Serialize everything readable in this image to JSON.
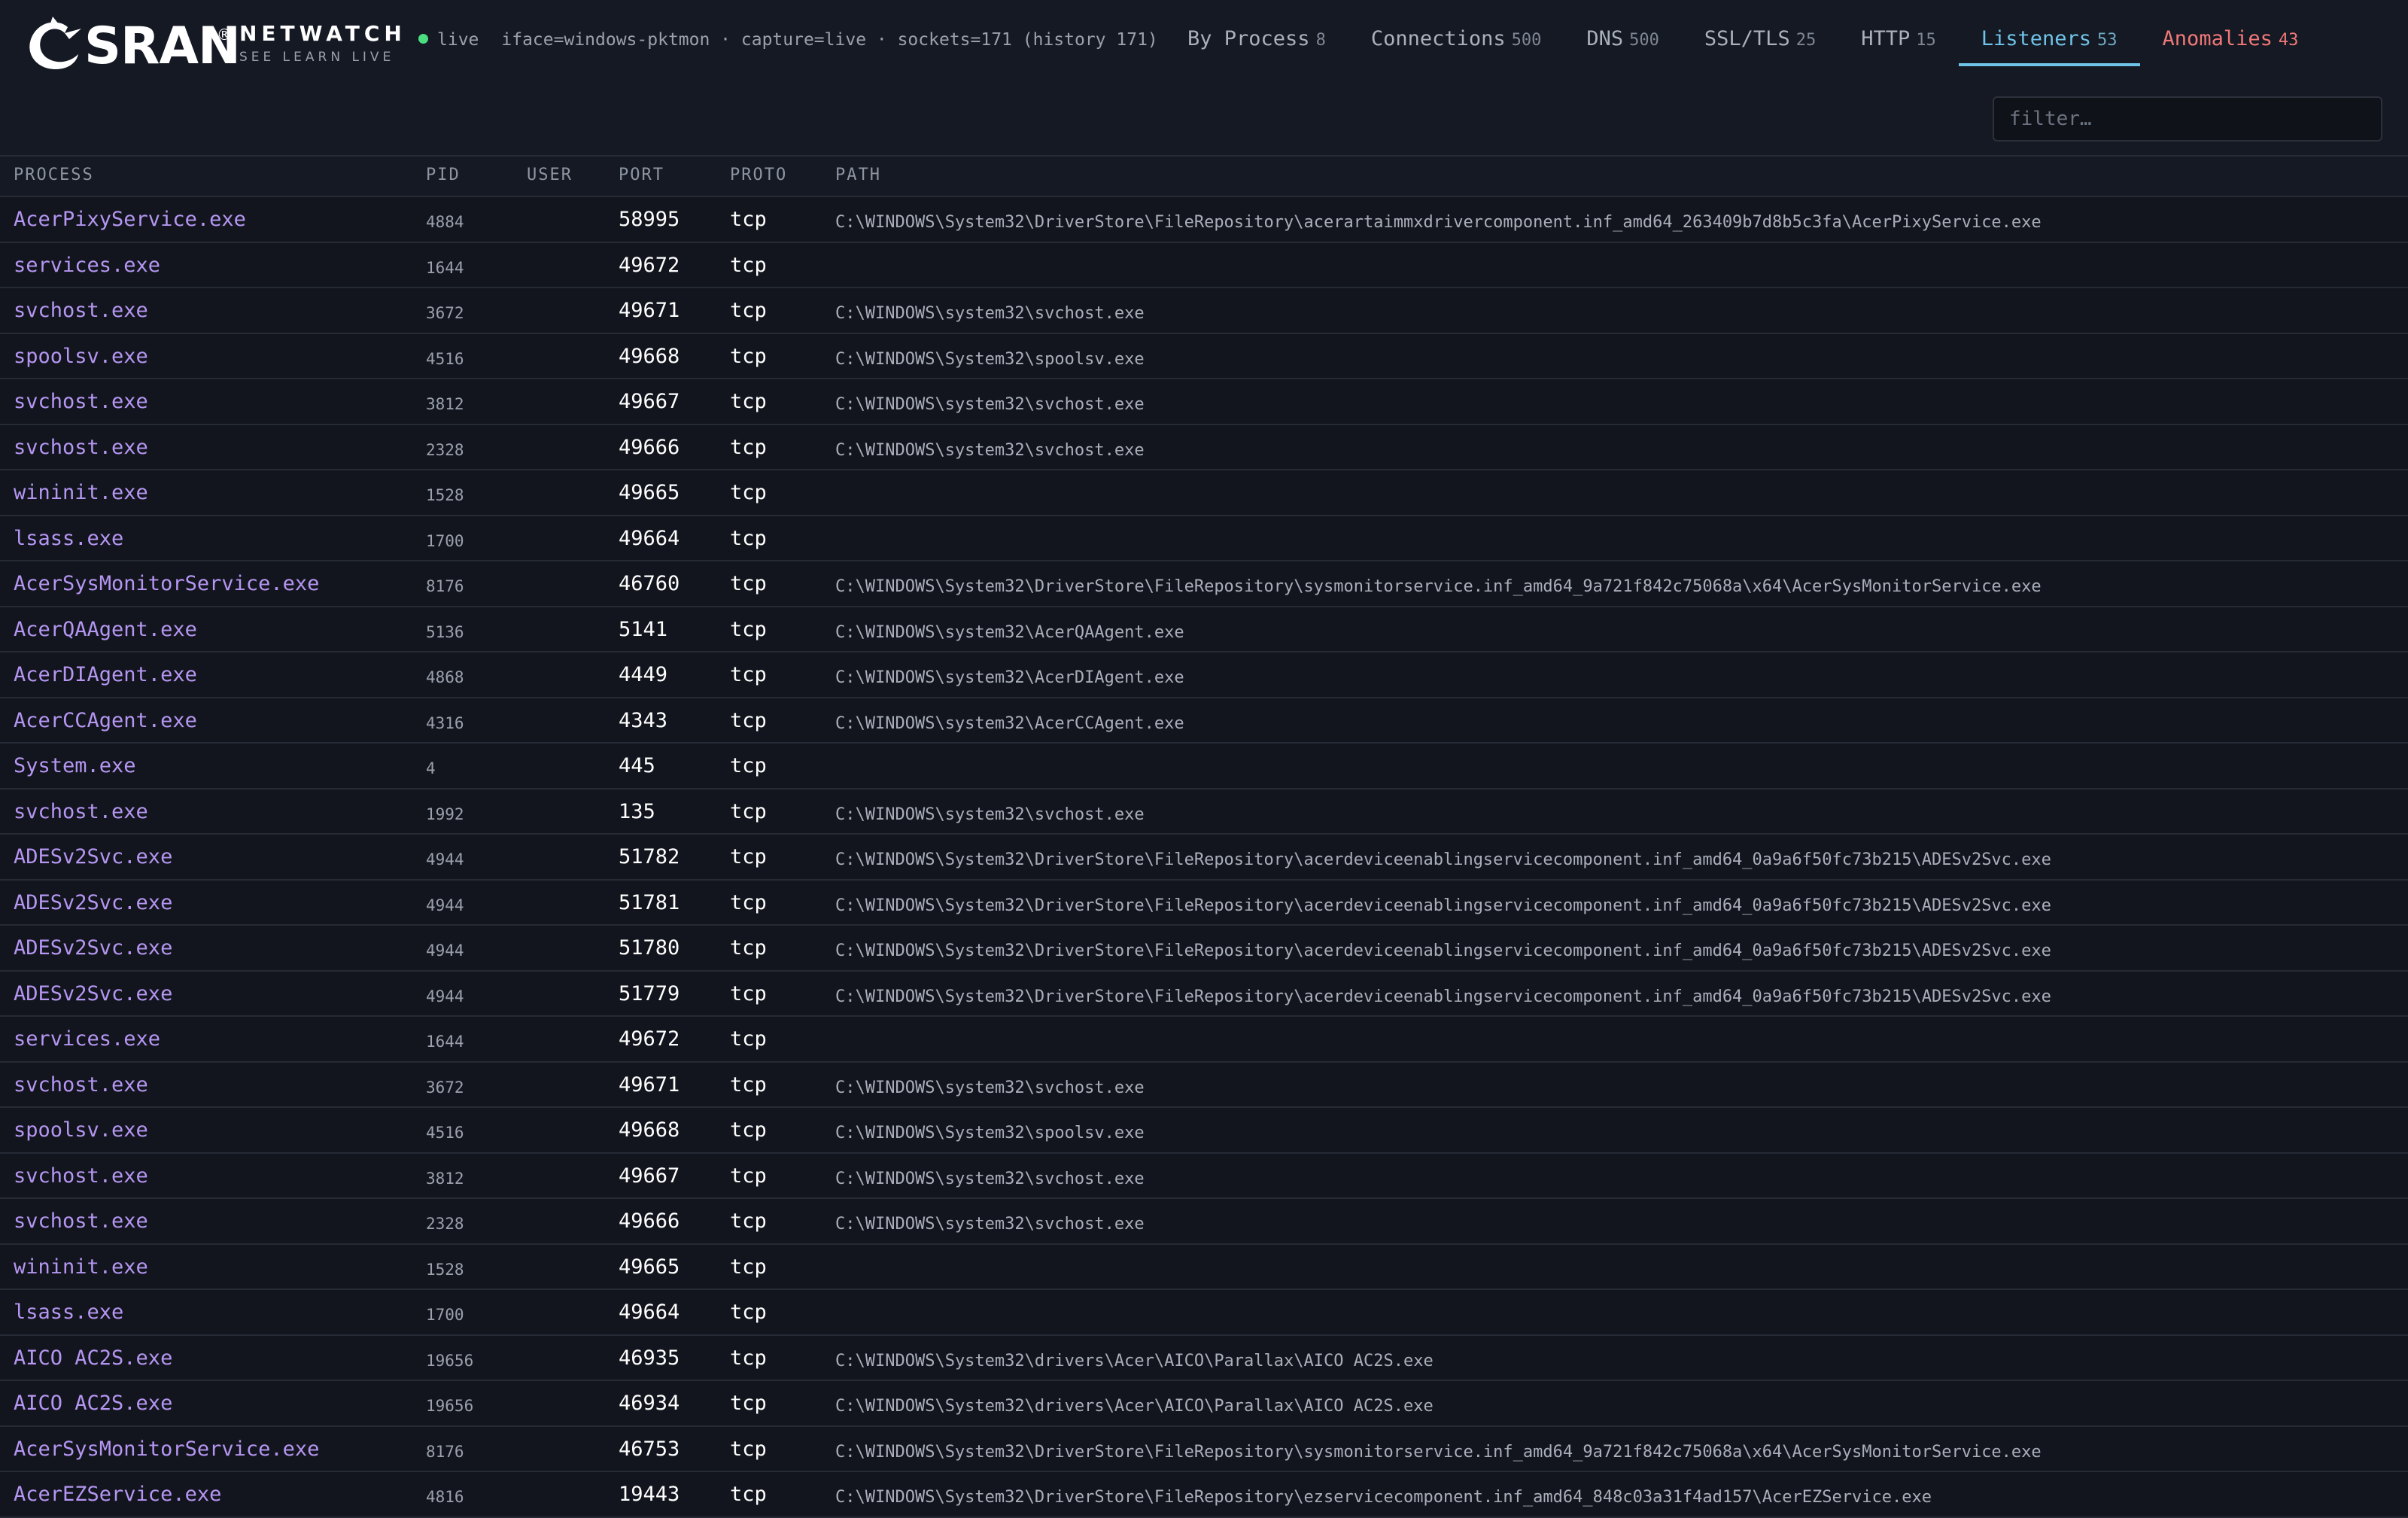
{
  "brand": {
    "name": "SRAN",
    "registered": "®",
    "product": "NETWATCH",
    "tagline": "SEE LEARN LIVE"
  },
  "status": {
    "live_label": "live",
    "details": "iface=windows-pktmon · capture=live · sockets=171 (history 171)"
  },
  "tabs": [
    {
      "label": "By Process",
      "count": "8"
    },
    {
      "label": "Connections",
      "count": "500"
    },
    {
      "label": "DNS",
      "count": "500"
    },
    {
      "label": "SSL/TLS",
      "count": "25"
    },
    {
      "label": "HTTP",
      "count": "15"
    },
    {
      "label": "Listeners",
      "count": "53"
    },
    {
      "label": "Anomalies",
      "count": "43"
    }
  ],
  "active_tab": "Listeners",
  "filter": {
    "placeholder": "filter…",
    "value": ""
  },
  "columns": {
    "process": "PROCESS",
    "pid": "PID",
    "user": "USER",
    "port": "PORT",
    "proto": "PROTO",
    "path": "PATH"
  },
  "rows": [
    {
      "process": "AcerPixyService.exe",
      "pid": "4884",
      "user": "",
      "port": "58995",
      "proto": "tcp",
      "path": "C:\\WINDOWS\\System32\\DriverStore\\FileRepository\\acerartaimmxdrivercomponent.inf_amd64_263409b7d8b5c3fa\\AcerPixyService.exe"
    },
    {
      "process": "services.exe",
      "pid": "1644",
      "user": "",
      "port": "49672",
      "proto": "tcp",
      "path": ""
    },
    {
      "process": "svchost.exe",
      "pid": "3672",
      "user": "",
      "port": "49671",
      "proto": "tcp",
      "path": "C:\\WINDOWS\\system32\\svchost.exe"
    },
    {
      "process": "spoolsv.exe",
      "pid": "4516",
      "user": "",
      "port": "49668",
      "proto": "tcp",
      "path": "C:\\WINDOWS\\System32\\spoolsv.exe"
    },
    {
      "process": "svchost.exe",
      "pid": "3812",
      "user": "",
      "port": "49667",
      "proto": "tcp",
      "path": "C:\\WINDOWS\\system32\\svchost.exe"
    },
    {
      "process": "svchost.exe",
      "pid": "2328",
      "user": "",
      "port": "49666",
      "proto": "tcp",
      "path": "C:\\WINDOWS\\system32\\svchost.exe"
    },
    {
      "process": "wininit.exe",
      "pid": "1528",
      "user": "",
      "port": "49665",
      "proto": "tcp",
      "path": ""
    },
    {
      "process": "lsass.exe",
      "pid": "1700",
      "user": "",
      "port": "49664",
      "proto": "tcp",
      "path": ""
    },
    {
      "process": "AcerSysMonitorService.exe",
      "pid": "8176",
      "user": "",
      "port": "46760",
      "proto": "tcp",
      "path": "C:\\WINDOWS\\System32\\DriverStore\\FileRepository\\sysmonitorservice.inf_amd64_9a721f842c75068a\\x64\\AcerSysMonitorService.exe"
    },
    {
      "process": "AcerQAAgent.exe",
      "pid": "5136",
      "user": "",
      "port": "5141",
      "proto": "tcp",
      "path": "C:\\WINDOWS\\system32\\AcerQAAgent.exe"
    },
    {
      "process": "AcerDIAgent.exe",
      "pid": "4868",
      "user": "",
      "port": "4449",
      "proto": "tcp",
      "path": "C:\\WINDOWS\\system32\\AcerDIAgent.exe"
    },
    {
      "process": "AcerCCAgent.exe",
      "pid": "4316",
      "user": "",
      "port": "4343",
      "proto": "tcp",
      "path": "C:\\WINDOWS\\system32\\AcerCCAgent.exe"
    },
    {
      "process": "System.exe",
      "pid": "4",
      "user": "",
      "port": "445",
      "proto": "tcp",
      "path": ""
    },
    {
      "process": "svchost.exe",
      "pid": "1992",
      "user": "",
      "port": "135",
      "proto": "tcp",
      "path": "C:\\WINDOWS\\system32\\svchost.exe"
    },
    {
      "process": "ADESv2Svc.exe",
      "pid": "4944",
      "user": "",
      "port": "51782",
      "proto": "tcp",
      "path": "C:\\WINDOWS\\System32\\DriverStore\\FileRepository\\acerdeviceenablingservicecomponent.inf_amd64_0a9a6f50fc73b215\\ADESv2Svc.exe"
    },
    {
      "process": "ADESv2Svc.exe",
      "pid": "4944",
      "user": "",
      "port": "51781",
      "proto": "tcp",
      "path": "C:\\WINDOWS\\System32\\DriverStore\\FileRepository\\acerdeviceenablingservicecomponent.inf_amd64_0a9a6f50fc73b215\\ADESv2Svc.exe"
    },
    {
      "process": "ADESv2Svc.exe",
      "pid": "4944",
      "user": "",
      "port": "51780",
      "proto": "tcp",
      "path": "C:\\WINDOWS\\System32\\DriverStore\\FileRepository\\acerdeviceenablingservicecomponent.inf_amd64_0a9a6f50fc73b215\\ADESv2Svc.exe"
    },
    {
      "process": "ADESv2Svc.exe",
      "pid": "4944",
      "user": "",
      "port": "51779",
      "proto": "tcp",
      "path": "C:\\WINDOWS\\System32\\DriverStore\\FileRepository\\acerdeviceenablingservicecomponent.inf_amd64_0a9a6f50fc73b215\\ADESv2Svc.exe"
    },
    {
      "process": "services.exe",
      "pid": "1644",
      "user": "",
      "port": "49672",
      "proto": "tcp",
      "path": ""
    },
    {
      "process": "svchost.exe",
      "pid": "3672",
      "user": "",
      "port": "49671",
      "proto": "tcp",
      "path": "C:\\WINDOWS\\system32\\svchost.exe"
    },
    {
      "process": "spoolsv.exe",
      "pid": "4516",
      "user": "",
      "port": "49668",
      "proto": "tcp",
      "path": "C:\\WINDOWS\\System32\\spoolsv.exe"
    },
    {
      "process": "svchost.exe",
      "pid": "3812",
      "user": "",
      "port": "49667",
      "proto": "tcp",
      "path": "C:\\WINDOWS\\system32\\svchost.exe"
    },
    {
      "process": "svchost.exe",
      "pid": "2328",
      "user": "",
      "port": "49666",
      "proto": "tcp",
      "path": "C:\\WINDOWS\\system32\\svchost.exe"
    },
    {
      "process": "wininit.exe",
      "pid": "1528",
      "user": "",
      "port": "49665",
      "proto": "tcp",
      "path": ""
    },
    {
      "process": "lsass.exe",
      "pid": "1700",
      "user": "",
      "port": "49664",
      "proto": "tcp",
      "path": ""
    },
    {
      "process": "AICO AC2S.exe",
      "pid": "19656",
      "user": "",
      "port": "46935",
      "proto": "tcp",
      "path": "C:\\WINDOWS\\System32\\drivers\\Acer\\AICO\\Parallax\\AICO AC2S.exe"
    },
    {
      "process": "AICO AC2S.exe",
      "pid": "19656",
      "user": "",
      "port": "46934",
      "proto": "tcp",
      "path": "C:\\WINDOWS\\System32\\drivers\\Acer\\AICO\\Parallax\\AICO AC2S.exe"
    },
    {
      "process": "AcerSysMonitorService.exe",
      "pid": "8176",
      "user": "",
      "port": "46753",
      "proto": "tcp",
      "path": "C:\\WINDOWS\\System32\\DriverStore\\FileRepository\\sysmonitorservice.inf_amd64_9a721f842c75068a\\x64\\AcerSysMonitorService.exe"
    },
    {
      "process": "AcerEZService.exe",
      "pid": "4816",
      "user": "",
      "port": "19443",
      "proto": "tcp",
      "path": "C:\\WINDOWS\\System32\\DriverStore\\FileRepository\\ezservicecomponent.inf_amd64_848c03a31f4ad157\\AcerEZService.exe"
    }
  ]
}
